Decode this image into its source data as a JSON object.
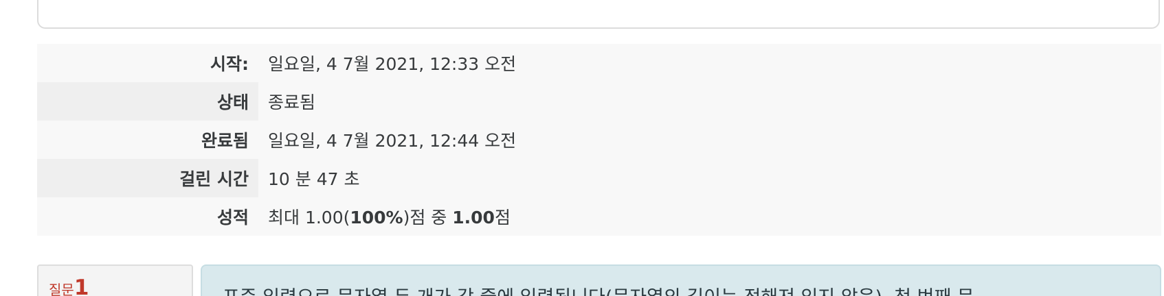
{
  "summary": {
    "rows": [
      {
        "label": "시작:",
        "value": "일요일, 4 7월 2021, 12:33 오전"
      },
      {
        "label": "상태",
        "value": "종료됨"
      },
      {
        "label": "완료됨",
        "value": "일요일, 4 7월 2021, 12:44 오전"
      },
      {
        "label": "걸린 시간",
        "value": "10 분 47 초"
      }
    ],
    "grade": {
      "label": "성적",
      "prefix": "최대 1.00(",
      "max_percent": "100%",
      "middle": ")점 중 ",
      "score": "1.00",
      "suffix": "점"
    }
  },
  "question": {
    "label": "질문",
    "number": "1",
    "text": "표준 입력으로 문자열 두 개가 각 줄에 입력됩니다(문자열의 길이는 정해져 있지 않음). 첫 번째 문"
  },
  "colors": {
    "question_number": "#c0392b",
    "question_bg": "#d9e9ed",
    "row_odd": "#f8f8f8",
    "row_even_label": "#efefef"
  }
}
